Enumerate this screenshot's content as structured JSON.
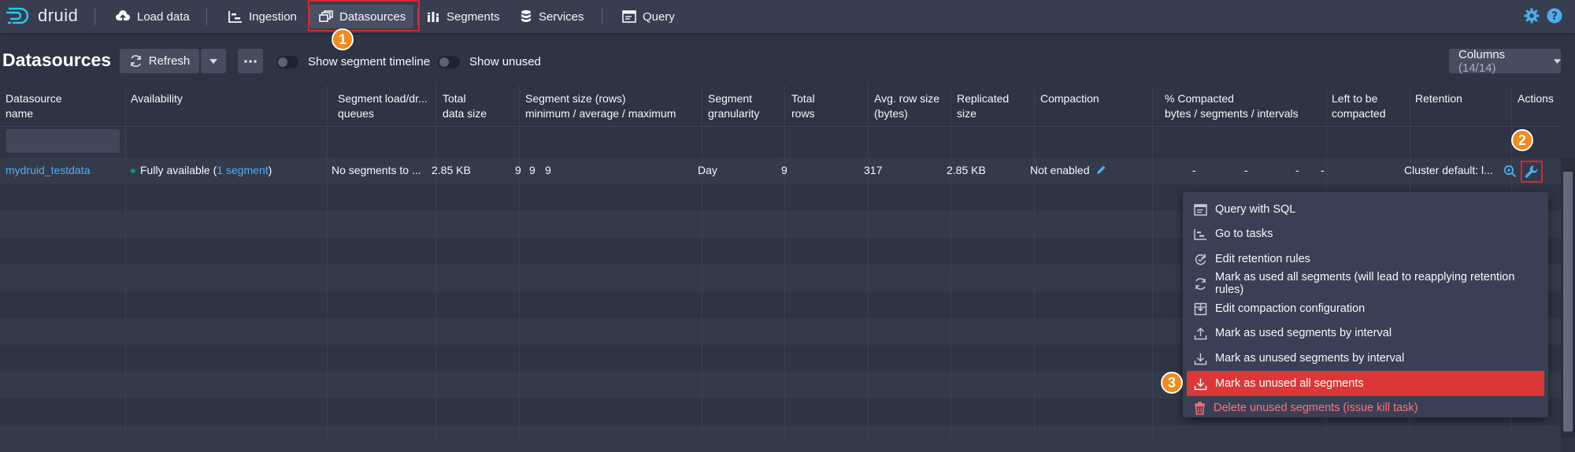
{
  "nav": {
    "logo": "druid",
    "items": [
      {
        "label": "Load data"
      },
      {
        "label": "Ingestion"
      },
      {
        "label": "Datasources"
      },
      {
        "label": "Segments"
      },
      {
        "label": "Services"
      },
      {
        "label": "Query"
      }
    ]
  },
  "header": {
    "title": "Datasources",
    "refresh_label": "Refresh",
    "show_segment_timeline": "Show segment timeline",
    "show_unused": "Show unused",
    "columns_label": "Columns",
    "columns_count": "(14/14)"
  },
  "table": {
    "headers": [
      {
        "l1": "Datasource",
        "l2": "name"
      },
      {
        "l1": "Availability",
        "l2": ""
      },
      {
        "l1": "Segment load/dr...",
        "l2": "queues"
      },
      {
        "l1": "Total",
        "l2": "data size"
      },
      {
        "l1": "Segment size (rows)",
        "l2": "minimum / average / maximum"
      },
      {
        "l1": "Segment",
        "l2": "granularity"
      },
      {
        "l1": "Total",
        "l2": "rows"
      },
      {
        "l1": "Avg. row size",
        "l2": "(bytes)"
      },
      {
        "l1": "Replicated",
        "l2": "size"
      },
      {
        "l1": "Compaction",
        "l2": ""
      },
      {
        "l1": "% Compacted",
        "l2": "bytes / segments / intervals"
      },
      {
        "l1": "Left to be",
        "l2": "compacted"
      },
      {
        "l1": "Retention",
        "l2": ""
      },
      {
        "l1": "Actions",
        "l2": ""
      }
    ],
    "row": {
      "name": "mydruid_testdata",
      "availability_prefix": "Fully available (",
      "availability_link": "1 segment",
      "availability_suffix": ")",
      "load_queue": "No segments to ...",
      "total_size": "2.85 KB",
      "seg_min": "9",
      "seg_avg": "9",
      "seg_max": "9",
      "granularity": "Day",
      "total_rows": "9",
      "avg_row_size": "317",
      "replicated_size": "2.85 KB",
      "compaction": "Not enabled",
      "compacted_bytes": "-",
      "compacted_segments": "-",
      "compacted_intervals": "-",
      "left_to_compact": "-",
      "retention": "Cluster default: l..."
    }
  },
  "menu": {
    "items": [
      {
        "label": "Query with SQL",
        "icon": "application-icon"
      },
      {
        "label": "Go to tasks",
        "icon": "gantt-chart-icon"
      },
      {
        "label": "Edit retention rules",
        "icon": "automatic-updates-icon"
      },
      {
        "label": "Mark as used all segments (will lead to reapplying retention rules)",
        "icon": "refresh-icon"
      },
      {
        "label": "Edit compaction configuration",
        "icon": "compressed-icon"
      },
      {
        "label": "Mark as used segments by interval",
        "icon": "upload-icon"
      },
      {
        "label": "Mark as unused segments by interval",
        "icon": "download-icon"
      },
      {
        "label": "Mark as unused all segments",
        "icon": "download-icon"
      },
      {
        "label": "Delete unused segments (issue kill task)",
        "icon": "trash-icon"
      }
    ]
  },
  "annotations": [
    "1",
    "2",
    "3"
  ],
  "colors": {
    "accent": "#48aff0",
    "danger": "#db3737",
    "badge": "#f28a1c"
  }
}
